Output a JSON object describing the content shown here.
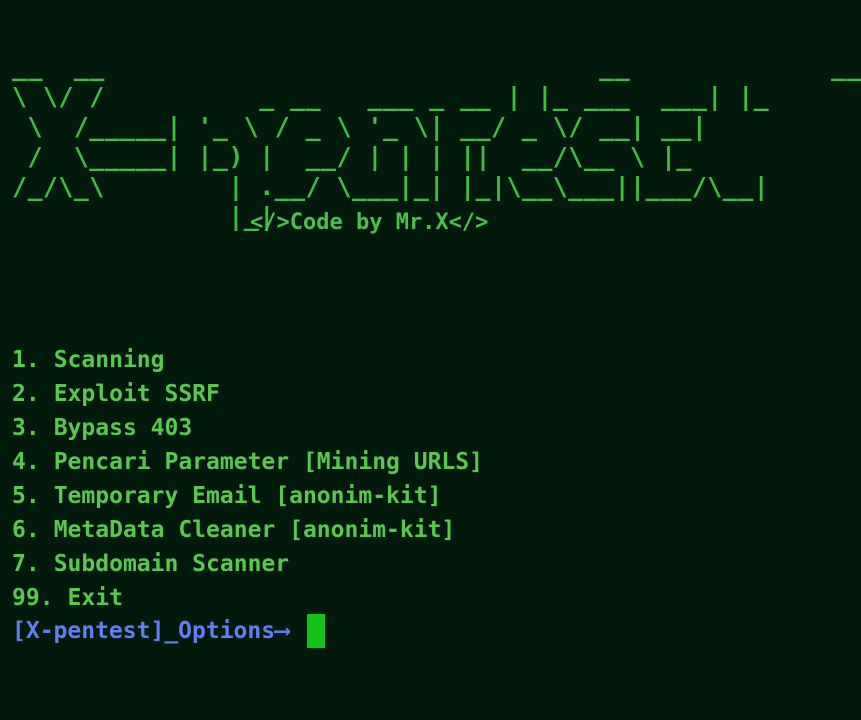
{
  "banner": {
    "ascii_art": "__  __                                __             __\n\\ \\/ /          _ __   ___ _ __ | |_ ___  ___| |_\n \\  /_____| '_ \\ / _ \\ '_ \\| __/ _ \\/ __| __|\n /  \\_____| |_) |  __/ | | | ||  __/\\__ \\ |_\n/_/\\_\\        | .__/ \\___|_| |_|\\__\\___||___/\\__|\n              |_|",
    "credit": "</>Code by Mr.X</>"
  },
  "menu": {
    "items": [
      {
        "num": "1.",
        "label": "Scanning"
      },
      {
        "num": "2.",
        "label": "Exploit SSRF"
      },
      {
        "num": "3.",
        "label": "Bypass 403"
      },
      {
        "num": "4.",
        "label": "Pencari Parameter [Mining URLS]"
      },
      {
        "num": "5.",
        "label": "Temporary Email [anonim-kit]"
      },
      {
        "num": "6.",
        "label": "MetaData Cleaner [anonim-kit]"
      },
      {
        "num": "7.",
        "label": "Subdomain Scanner"
      },
      {
        "num": "99.",
        "label": "Exit"
      }
    ]
  },
  "prompt": {
    "text": "[X-pentest]_Options⟶ "
  },
  "colors": {
    "background": "#011a0b",
    "banner": "#3fbf3f",
    "menu_text": "#58c84e",
    "prompt": "#5f7ff5",
    "cursor": "#12c21a"
  }
}
